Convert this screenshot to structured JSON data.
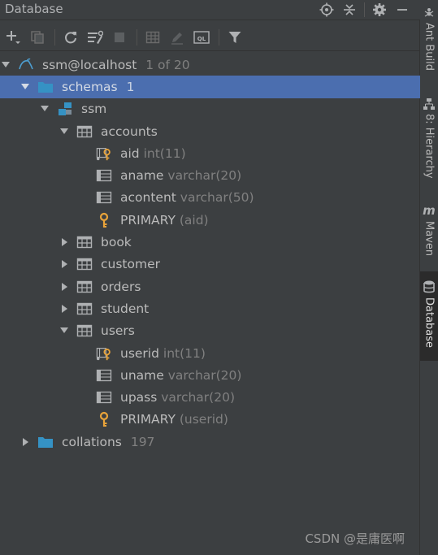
{
  "window": {
    "title": "Database"
  },
  "toolbar": {
    "buttons": [
      "add",
      "duplicate",
      "refresh",
      "db-settings",
      "stop",
      "table-editor",
      "edit",
      "ql-console",
      "filter"
    ]
  },
  "tree": {
    "connection": {
      "name": "ssm@localhost",
      "count": "1 of 20"
    },
    "schemas": {
      "name": "schemas",
      "count": "1"
    },
    "schema": {
      "name": "ssm"
    },
    "tables": [
      {
        "name": "accounts",
        "expanded": true,
        "columns": [
          {
            "name": "aid",
            "type": "int(11)",
            "pk": true
          },
          {
            "name": "aname",
            "type": "varchar(20)",
            "pk": false
          },
          {
            "name": "acontent",
            "type": "varchar(50)",
            "pk": false
          }
        ],
        "key": {
          "name": "PRIMARY",
          "cols": "(aid)"
        }
      },
      {
        "name": "book",
        "expanded": false
      },
      {
        "name": "customer",
        "expanded": false
      },
      {
        "name": "orders",
        "expanded": false
      },
      {
        "name": "student",
        "expanded": false
      },
      {
        "name": "users",
        "expanded": true,
        "columns": [
          {
            "name": "userid",
            "type": "int(11)",
            "pk": true
          },
          {
            "name": "uname",
            "type": "varchar(20)",
            "pk": false
          },
          {
            "name": "upass",
            "type": "varchar(20)",
            "pk": false
          }
        ],
        "key": {
          "name": "PRIMARY",
          "cols": "(userid)"
        }
      }
    ],
    "collations": {
      "name": "collations",
      "count": "197"
    }
  },
  "rightbar": {
    "tabs": [
      "Ant Build",
      "8: Hierarchy",
      "Maven",
      "Database"
    ]
  },
  "watermark": "CSDN @是庸医啊",
  "colors": {
    "background": "#3c3f41",
    "selection": "#4b6eaf",
    "folder": "#3592c4",
    "key": "#e8a33a"
  }
}
